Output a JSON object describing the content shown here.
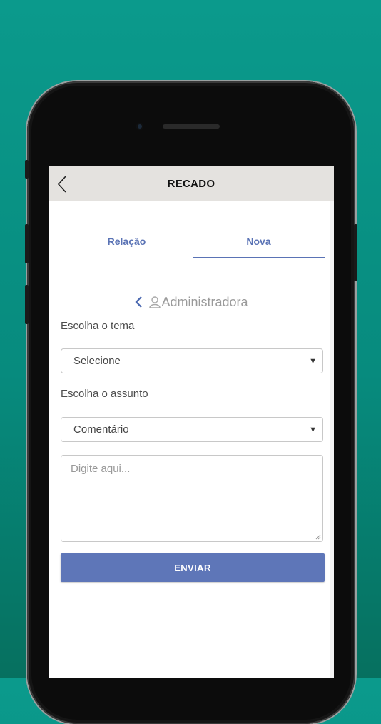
{
  "header": {
    "title": "RECADO"
  },
  "tabs": [
    {
      "label": "Relação",
      "active": false
    },
    {
      "label": "Nova",
      "active": true
    }
  ],
  "recipient": {
    "name": "Administradora"
  },
  "form": {
    "theme_label": "Escolha o tema",
    "theme_value": "Selecione",
    "subject_label": "Escolha o assunto",
    "subject_value": "Comentário",
    "message_placeholder": "Digite aqui...",
    "send_label": "ENVIAR"
  },
  "colors": {
    "background": "#0b9a8c",
    "accent": "#5e76b8",
    "topbar": "#e4e2df"
  },
  "icons": [
    "back-arrow-icon",
    "chevron-left-icon",
    "user-icon",
    "caret-down-icon"
  ]
}
